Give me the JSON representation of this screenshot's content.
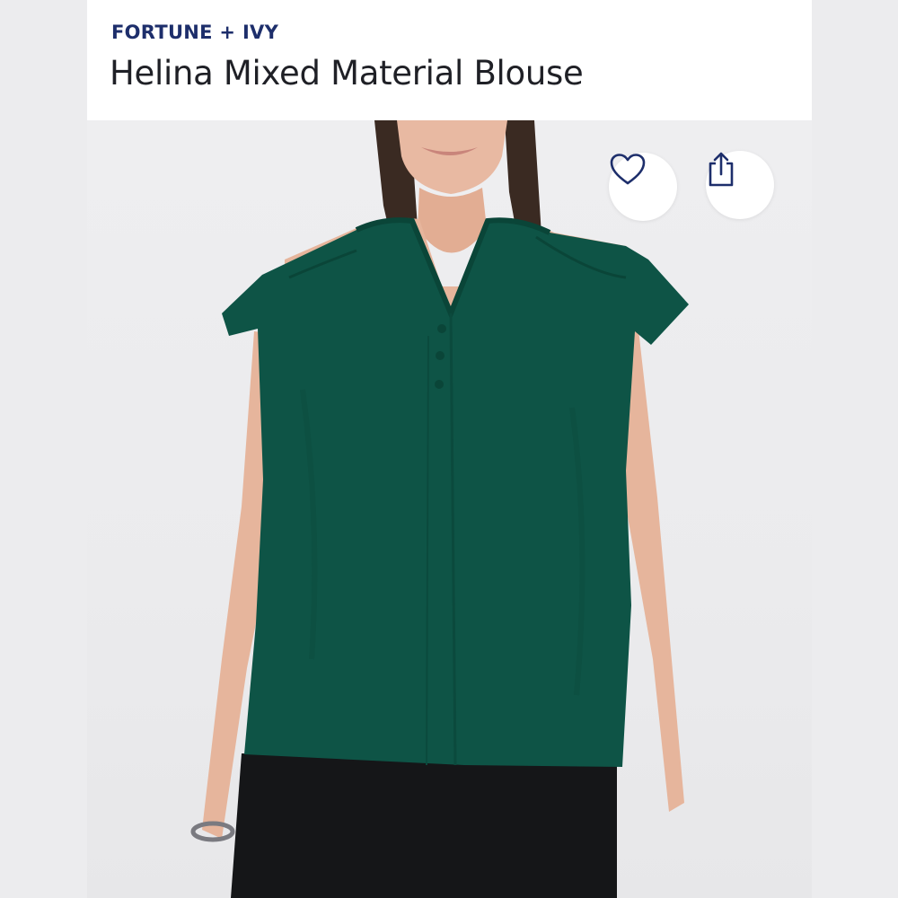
{
  "product": {
    "brand": "FORTUNE + IVY",
    "title": "Helina Mixed Material Blouse"
  },
  "actions": {
    "favorite_icon": "heart-icon",
    "share_icon": "share-icon"
  },
  "colors": {
    "brand_text": "#1d2e6b",
    "title_text": "#1f2026",
    "blouse": "#0e5446",
    "background": "#ececee"
  }
}
